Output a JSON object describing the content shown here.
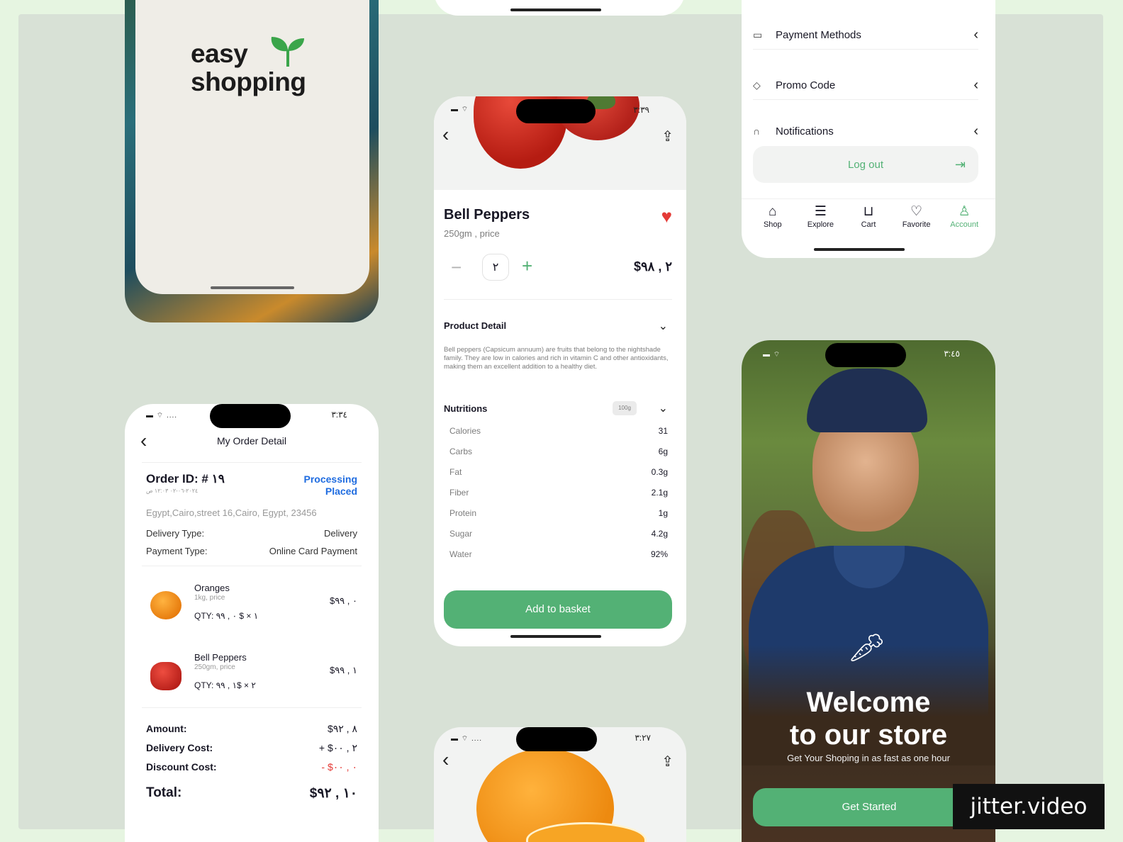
{
  "splash": {
    "logo_line1": "easy",
    "logo_line2": "shopping"
  },
  "account": {
    "menu": [
      {
        "label": "Payment Methods",
        "icon": "card-icon"
      },
      {
        "label": "Promo Code",
        "icon": "tag-icon"
      },
      {
        "label": "Notifications",
        "icon": "bell-icon"
      }
    ],
    "logout_label": "Log out",
    "tabs": [
      {
        "label": "Shop",
        "icon": "shop-icon",
        "active": false
      },
      {
        "label": "Explore",
        "icon": "explore-icon",
        "active": false
      },
      {
        "label": "Cart",
        "icon": "cart-icon",
        "active": false
      },
      {
        "label": "Favorite",
        "icon": "heart-icon",
        "active": false
      },
      {
        "label": "Account",
        "icon": "user-icon",
        "active": true
      }
    ]
  },
  "product": {
    "status_time": "٣:٣٩",
    "name": "Bell Peppers",
    "subtitle": "250gm , price",
    "quantity": "٢",
    "price": "$٢ , ٩٨",
    "detail_title": "Product Detail",
    "description": "Bell peppers (Capsicum annuum) are fruits that belong to the nightshade family. They are low in calories and rich in vitamin C and other antioxidants, making them an excellent addition to a healthy diet.",
    "nutrition_title": "Nutritions",
    "nutrition_badge": "100g",
    "nutritions": [
      {
        "name": "Calories",
        "value": "31"
      },
      {
        "name": "Carbs",
        "value": "6g"
      },
      {
        "name": "Fat",
        "value": "0.3g"
      },
      {
        "name": "Fiber",
        "value": "2.1g"
      },
      {
        "name": "Protein",
        "value": "1g"
      },
      {
        "name": "Sugar",
        "value": "4.2g"
      },
      {
        "name": "Water",
        "value": "92%"
      }
    ],
    "add_button": "Add to basket"
  },
  "order": {
    "status_time": "٣:٣٤",
    "title": "My Order Detail",
    "order_id": "Order ID: # ١٩",
    "date": "٢٠٢٤-٠٦-٠٢ ١٢:٠٣ ص",
    "status_line1": "Processing",
    "status_line2": "Placed",
    "address": "Egypt,Cairo,street 16,Cairo, Egypt, 23456",
    "delivery_type_label": "Delivery Type:",
    "delivery_type_value": "Delivery",
    "payment_type_label": "Payment Type:",
    "payment_type_value": "Online Card Payment",
    "items": [
      {
        "name": "Oranges",
        "sub": "1kg, price",
        "qty": "QTY: ١ × $ ٠ , ٩٩",
        "price": "$٠ , ٩٩"
      },
      {
        "name": "Bell Peppers",
        "sub": "250gm, price",
        "qty": "QTY: ٢ × $١ , ٩٩",
        "price": "$١ , ٩٩"
      }
    ],
    "amount_label": "Amount:",
    "amount_value": "$٨ , ٩٢",
    "delivery_cost_label": "Delivery Cost:",
    "delivery_cost_value": "+ $٢ , ٠٠",
    "discount_label": "Discount Cost:",
    "discount_value": "- $٠ , ٠٠",
    "total_label": "Total:",
    "total_value": "$١٠ , ٩٢"
  },
  "welcome": {
    "status_time": "٣:٤٥",
    "title_line1": "Welcome",
    "title_line2": "to our store",
    "subtitle": "Get Your Shoping in as fast as one hour",
    "button": "Get Started"
  },
  "product2": {
    "status_time": "٣:٢٧"
  },
  "watermark": "jitter.video",
  "colors": {
    "accent_green": "#53b175",
    "status_blue": "#1f6ce0",
    "heart_red": "#e43b37",
    "board_bg": "#d8e1d6",
    "page_bg": "#e6f5e1"
  }
}
